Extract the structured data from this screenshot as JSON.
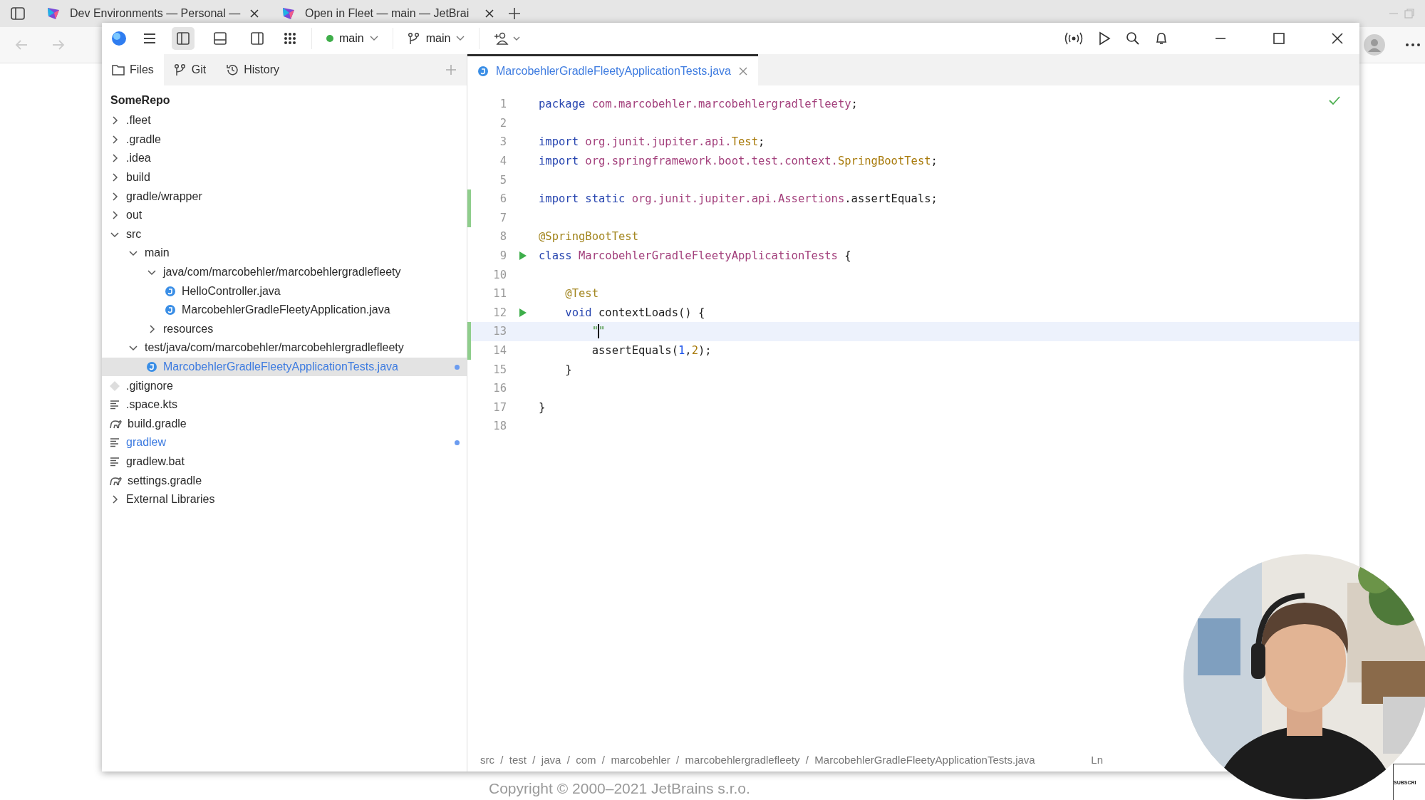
{
  "browser": {
    "tabs": [
      {
        "title": "Dev Environments — Personal —"
      },
      {
        "title": "Open in Fleet — main — JetBrai"
      }
    ]
  },
  "toolbar": {
    "panel_toggles": [
      {
        "kind": "left",
        "selected": true
      },
      {
        "kind": "bottom",
        "selected": false
      },
      {
        "kind": "right",
        "selected": false
      }
    ],
    "workspace": "main",
    "branch": "main"
  },
  "sidebar": {
    "tabs": [
      {
        "label": "Files",
        "selected": true
      },
      {
        "label": "Git",
        "selected": false
      },
      {
        "label": "History",
        "selected": false
      }
    ],
    "root": "SomeRepo",
    "tree": [
      {
        "name": ".fleet",
        "kind": "folder",
        "expanded": false,
        "selected": false,
        "modified": false
      },
      {
        "name": ".gradle",
        "kind": "folder",
        "expanded": false,
        "selected": false,
        "modified": false
      },
      {
        "name": ".idea",
        "kind": "folder",
        "expanded": false,
        "selected": false,
        "modified": false
      },
      {
        "name": "build",
        "kind": "folder",
        "expanded": false,
        "selected": false,
        "modified": false
      },
      {
        "name": "gradle/wrapper",
        "kind": "folder",
        "expanded": false,
        "selected": false,
        "modified": false
      },
      {
        "name": "out",
        "kind": "folder",
        "expanded": false,
        "selected": false,
        "modified": false
      },
      {
        "name": "src",
        "kind": "folder",
        "expanded": true,
        "selected": false,
        "modified": false,
        "children": [
          {
            "name": "main",
            "kind": "folder",
            "expanded": true,
            "selected": false,
            "modified": false,
            "children": [
              {
                "name": "java/com/marcobehler/marcobehlergradlefleety",
                "kind": "folder",
                "expanded": true,
                "selected": false,
                "modified": false,
                "children": [
                  {
                    "name": "HelloController.java",
                    "kind": "java",
                    "selected": false,
                    "modified": false
                  },
                  {
                    "name": "MarcobehlerGradleFleetyApplication.java",
                    "kind": "java",
                    "selected": false,
                    "modified": false
                  }
                ]
              },
              {
                "name": "resources",
                "kind": "folder",
                "expanded": false,
                "selected": false,
                "modified": false
              }
            ]
          },
          {
            "name": "test/java/com/marcobehler/marcobehlergradlefleety",
            "kind": "folder",
            "expanded": true,
            "selected": false,
            "modified": false,
            "children": [
              {
                "name": "MarcobehlerGradleFleetyApplicationTests.java",
                "kind": "java",
                "selected": true,
                "modified": true
              }
            ]
          }
        ]
      },
      {
        "name": ".gitignore",
        "kind": "ignore",
        "selected": false,
        "modified": false
      },
      {
        "name": ".space.kts",
        "kind": "text",
        "selected": false,
        "modified": false
      },
      {
        "name": "build.gradle",
        "kind": "gradle",
        "selected": false,
        "modified": false
      },
      {
        "name": "gradlew",
        "kind": "text",
        "selected": false,
        "modified": true
      },
      {
        "name": "gradlew.bat",
        "kind": "text",
        "selected": false,
        "modified": false
      },
      {
        "name": "settings.gradle",
        "kind": "gradle",
        "selected": false,
        "modified": false
      },
      {
        "name": "External Libraries",
        "kind": "folder",
        "expanded": false,
        "selected": false,
        "modified": false
      }
    ]
  },
  "editor": {
    "tab": "MarcobehlerGradleFleetyApplicationTests.java",
    "lines": [
      {
        "number": "1",
        "changed": false,
        "runnable": false,
        "current": false,
        "tokens": [
          {
            "kind": "keyword",
            "text": "package "
          },
          {
            "kind": "ref",
            "text": "com.marcobehler.marcobehlergradlefleety"
          },
          {
            "kind": "plain",
            "text": ";"
          }
        ]
      },
      {
        "number": "2",
        "changed": false,
        "runnable": false,
        "current": false
      },
      {
        "number": "3",
        "changed": false,
        "runnable": false,
        "current": false,
        "tokens": [
          {
            "kind": "keyword",
            "text": "import "
          },
          {
            "kind": "ref",
            "text": "org.junit.jupiter.api."
          },
          {
            "kind": "type",
            "text": "Test"
          },
          {
            "kind": "plain",
            "text": ";"
          }
        ]
      },
      {
        "number": "4",
        "changed": false,
        "runnable": false,
        "current": false,
        "tokens": [
          {
            "kind": "keyword",
            "text": "import "
          },
          {
            "kind": "ref",
            "text": "org.springframework.boot.test.context."
          },
          {
            "kind": "type",
            "text": "SpringBootTest"
          },
          {
            "kind": "plain",
            "text": ";"
          }
        ]
      },
      {
        "number": "5",
        "changed": false,
        "runnable": false,
        "current": false
      },
      {
        "number": "6",
        "changed": true,
        "runnable": false,
        "current": false,
        "tokens": [
          {
            "kind": "keyword",
            "text": "import static "
          },
          {
            "kind": "ref",
            "text": "org.junit.jupiter.api.Assertions"
          },
          {
            "kind": "plain",
            "text": ".assertEquals;"
          }
        ]
      },
      {
        "number": "7",
        "changed": true,
        "runnable": false,
        "current": false
      },
      {
        "number": "8",
        "changed": false,
        "runnable": false,
        "current": false,
        "tokens": [
          {
            "kind": "annotation",
            "text": "@SpringBootTest"
          }
        ]
      },
      {
        "number": "9",
        "changed": false,
        "runnable": true,
        "current": false,
        "tokens": [
          {
            "kind": "keyword",
            "text": "class "
          },
          {
            "kind": "ref",
            "text": "MarcobehlerGradleFleetyApplicationTests"
          },
          {
            "kind": "plain",
            "text": " {"
          }
        ]
      },
      {
        "number": "10",
        "changed": false,
        "runnable": false,
        "current": false
      },
      {
        "number": "11",
        "changed": false,
        "runnable": false,
        "current": false,
        "tokens": [
          {
            "kind": "annotation",
            "text": "    @Test"
          }
        ]
      },
      {
        "number": "12",
        "changed": false,
        "runnable": true,
        "current": false,
        "tokens": [
          {
            "kind": "keyword",
            "text": "    void"
          },
          {
            "kind": "plain",
            "text": " contextLoads() {"
          }
        ]
      },
      {
        "number": "13",
        "changed": true,
        "runnable": false,
        "current": true,
        "tokens": [
          {
            "kind": "string",
            "text": "        \""
          },
          {
            "kind": "string",
            "text": "\"",
            "caret": true
          }
        ]
      },
      {
        "number": "14",
        "changed": true,
        "runnable": false,
        "current": false,
        "tokens": [
          {
            "kind": "plain",
            "text": "        assertEquals("
          },
          {
            "kind": "number",
            "text": "1"
          },
          {
            "kind": "plain",
            "text": ","
          },
          {
            "kind": "type",
            "text": "2"
          },
          {
            "kind": "plain",
            "text": ");"
          }
        ]
      },
      {
        "number": "15",
        "changed": false,
        "runnable": false,
        "current": false,
        "tokens": [
          {
            "kind": "plain",
            "text": "    }"
          }
        ]
      },
      {
        "number": "16",
        "changed": false,
        "runnable": false,
        "current": false
      },
      {
        "number": "17",
        "changed": false,
        "runnable": false,
        "current": false,
        "tokens": [
          {
            "kind": "plain",
            "text": "}"
          }
        ]
      },
      {
        "number": "18",
        "changed": false,
        "runnable": false,
        "current": false
      }
    ],
    "breadcrumb": "src  /  test  /  java  /  com  /  marcobehler  /  marcobehlergradlefleety  /  MarcobehlerGradleFleetyApplicationTests.java",
    "position": "Ln"
  },
  "footer": "Copyright © 2000–2021 JetBrains s.r.o.",
  "webcam": {
    "kind": "picture",
    "badge": "SUBSCRI"
  }
}
